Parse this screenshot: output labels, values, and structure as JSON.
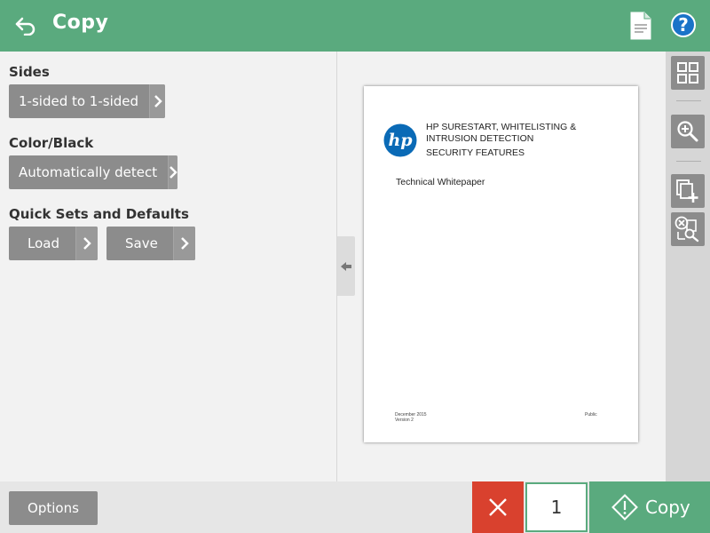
{
  "header": {
    "title": "Copy",
    "help_label": "?"
  },
  "settings": {
    "sides": {
      "label": "Sides",
      "value": "1-sided to 1-sided"
    },
    "color": {
      "label": "Color/Black",
      "value": "Automatically detect"
    },
    "quick_sets": {
      "label": "Quick Sets and Defaults",
      "load_label": "Load",
      "save_label": "Save"
    }
  },
  "preview": {
    "doc_title_line1": "HP SURESTART, WHITELISTING &",
    "doc_title_line2": "INTRUSION DETECTION",
    "doc_subtitle": "SECURITY FEATURES",
    "doc_type": "Technical Whitepaper",
    "doc_footer_date": "December 2015",
    "doc_footer_version": "Version 2",
    "doc_footer_right": "Public",
    "logo_text": "hp"
  },
  "toolbar": {
    "icons": [
      "grid-view-icon",
      "zoom-in-icon",
      "add-pages-icon",
      "remove-pages-icon"
    ]
  },
  "bottom": {
    "options_label": "Options",
    "copies": "1",
    "copy_label": "Copy"
  },
  "colors": {
    "header": "#5aaa7e",
    "button_gray": "#8c8c8c",
    "cancel_red": "#d9412e",
    "help_blue": "#1a73c8",
    "hp_blue": "#0a6ab6"
  }
}
